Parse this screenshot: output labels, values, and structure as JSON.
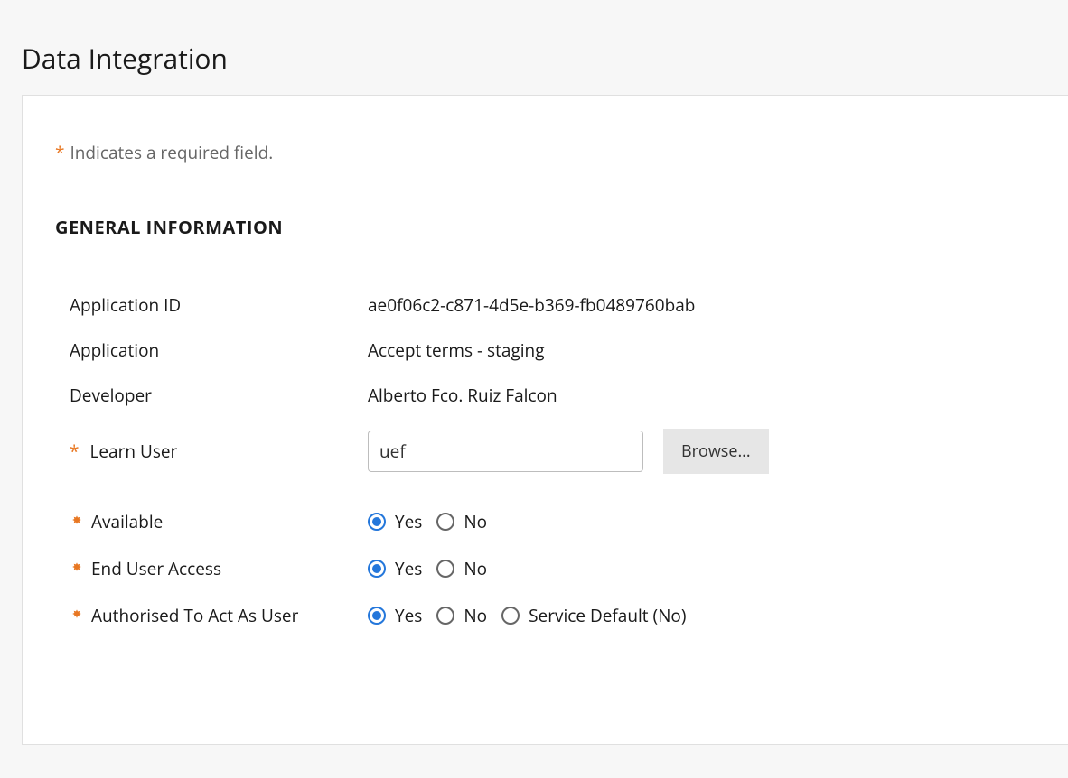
{
  "page": {
    "title": "Data Integration",
    "required_note_prefix": "*",
    "required_note": "Indicates a required field."
  },
  "section": {
    "title": "GENERAL INFORMATION"
  },
  "fields": {
    "application_id": {
      "label": "Application ID",
      "value": "ae0f06c2-c871-4d5e-b369-fb0489760bab"
    },
    "application": {
      "label": "Application",
      "value": "Accept terms - staging"
    },
    "developer": {
      "label": "Developer",
      "value": "Alberto Fco. Ruiz Falcon"
    },
    "learn_user": {
      "label": "Learn User",
      "value": "uef",
      "browse_label": "Browse..."
    },
    "available": {
      "label": "Available",
      "options": {
        "yes": "Yes",
        "no": "No"
      },
      "selected": "yes"
    },
    "end_user_access": {
      "label": "End User Access",
      "options": {
        "yes": "Yes",
        "no": "No"
      },
      "selected": "yes"
    },
    "authorised": {
      "label": "Authorised To Act As User",
      "options": {
        "yes": "Yes",
        "no": "No",
        "default": "Service Default (No)"
      },
      "selected": "yes"
    }
  }
}
